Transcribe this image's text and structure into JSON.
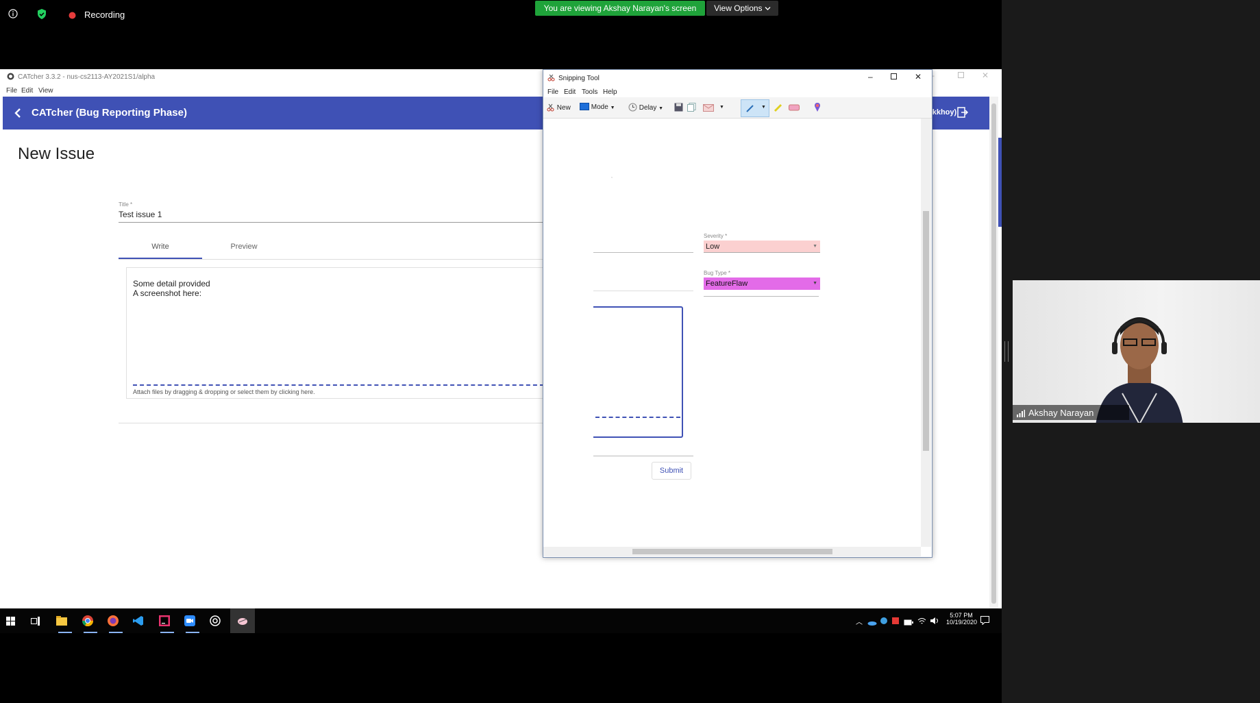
{
  "zoom": {
    "recording_label": "Recording",
    "viewing_banner": "You are viewing Akshay Narayan's screen",
    "view_options_label": "View Options",
    "participant_name": "Akshay Narayan"
  },
  "catcher": {
    "window_title": "CATcher 3.3.2 - nus-cs2113-AY2021S1/alpha",
    "menu": [
      "File",
      "Edit",
      "View"
    ],
    "header_title": "CATcher  (Bug Reporting Phase)",
    "header_user": "okkhoy)",
    "page_title": "New Issue",
    "title_label": "Title *",
    "title_value": "Test issue 1",
    "tabs": [
      "Write",
      "Preview"
    ],
    "description_lines": [
      "Some detail provided",
      "A screenshot here:"
    ],
    "attach_hint": "Attach files by dragging & dropping or select them by clicking here."
  },
  "snipping_tool": {
    "window_title": "Snipping Tool",
    "menu": [
      "File",
      "Edit",
      "Tools",
      "Help"
    ],
    "toolbar": {
      "new_label": "New",
      "mode_label": "Mode",
      "delay_label": "Delay"
    },
    "snip": {
      "severity_label": "Severity *",
      "severity_value": "Low",
      "bug_type_label": "Bug Type *",
      "bug_type_value": "FeatureFlaw",
      "submit_label": "Submit"
    }
  },
  "taskbar": {
    "time": "5:07 PM",
    "date": "10/19/2020"
  },
  "colors": {
    "catcher_header": "#3f51b5",
    "zoom_banner": "#1fa33a",
    "severity_bg": "#fbd0d0",
    "bug_type_bg": "#e36be8"
  }
}
